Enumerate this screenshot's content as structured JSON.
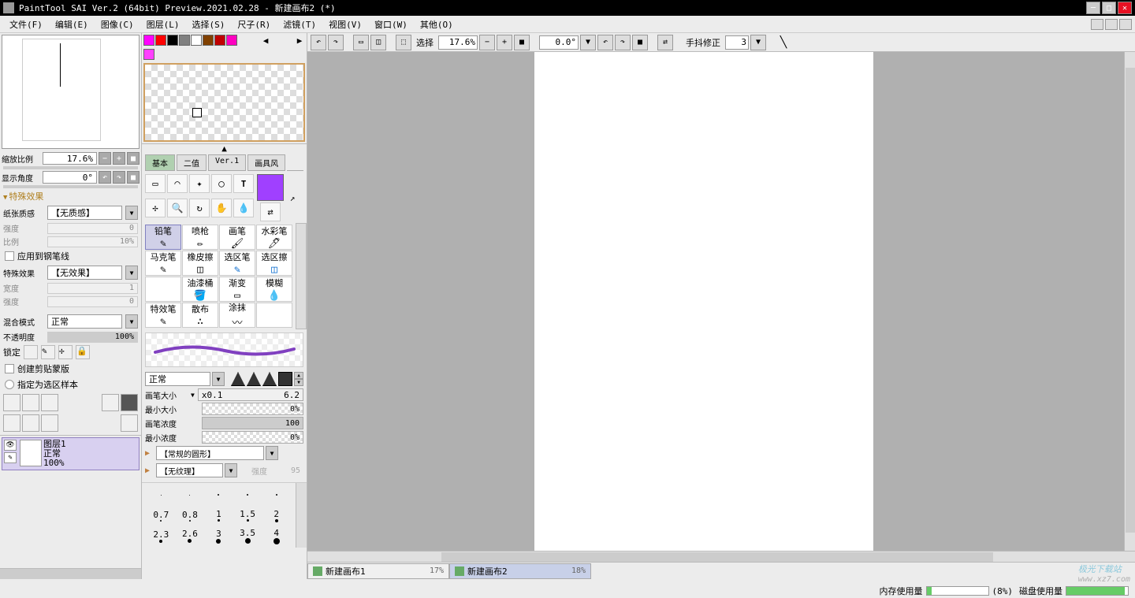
{
  "title": "PaintTool SAI Ver.2 (64bit) Preview.2021.02.28 - 新建画布2 (*)",
  "menu": [
    "文件(F)",
    "编辑(E)",
    "图像(C)",
    "图层(L)",
    "选择(S)",
    "尺子(R)",
    "滤镜(T)",
    "视图(V)",
    "窗口(W)",
    "其他(O)"
  ],
  "toolbar": {
    "select_label": "选择",
    "zoom": "17.6%",
    "rotation": "0.0°",
    "stabilizer_label": "手抖修正",
    "stabilizer_val": "3"
  },
  "nav": {
    "zoom_label": "缩放比例",
    "zoom_val": "17.6%",
    "angle_label": "显示角度",
    "angle_val": "0°"
  },
  "fx": {
    "header": "特殊效果",
    "paper_label": "纸张质感",
    "paper_val": "【无质感】",
    "strength_label": "强度",
    "strength_val": "0",
    "ratio_label": "比例",
    "ratio_val": "10%",
    "apply_pen": "应用到钢笔线",
    "effect_label": "特殊效果",
    "effect_val": "【无效果】",
    "width_label": "宽度",
    "width_val": "1",
    "strength2_label": "强度",
    "strength2_val": "0"
  },
  "blend": {
    "mode_label": "混合模式",
    "mode_val": "正常",
    "opacity_label": "不透明度",
    "opacity_val": "100%"
  },
  "lock": {
    "label": "锁定",
    "clip": "创建剪贴蒙版",
    "selsrc": "指定为选区样本"
  },
  "layer": {
    "name": "图层1",
    "mode": "正常",
    "opacity": "100%"
  },
  "swatches": [
    "#ff00ff",
    "#ff0000",
    "#000000",
    "#808080",
    "#ffffff",
    "#804000",
    "#c00000",
    "#ff00c0"
  ],
  "extra_swatch": "#ff40ff",
  "color_big": "#a040ff",
  "tabs": [
    "基本",
    "二值",
    "Ver.1",
    "画具风"
  ],
  "brushes": [
    {
      "n": "铅笔"
    },
    {
      "n": "喷枪"
    },
    {
      "n": "画笔"
    },
    {
      "n": "水彩笔"
    },
    {
      "n": "马克笔"
    },
    {
      "n": "橡皮擦"
    },
    {
      "n": "选区笔"
    },
    {
      "n": "选区擦"
    },
    {
      "n": ""
    },
    {
      "n": "油漆桶"
    },
    {
      "n": "渐变"
    },
    {
      "n": "模糊"
    },
    {
      "n": "特效笔"
    },
    {
      "n": "散布"
    },
    {
      "n": "涂抹"
    },
    {
      "n": ""
    }
  ],
  "brush_mode": "正常",
  "params": {
    "size_label": "画笔大小",
    "size_mult": "x0.1",
    "size_val": "6.2",
    "minsize_label": "最小大小",
    "minsize_val": "0%",
    "density_label": "画笔浓度",
    "density_val": "100",
    "mindensity_label": "最小浓度",
    "mindensity_val": "0%"
  },
  "tex": {
    "shape": "【常规的圆形】",
    "texture": "【无纹理】",
    "tex_strength_label": "强度",
    "tex_strength_val": "95"
  },
  "dots": {
    "r1": [
      "",
      "",
      ".",
      "",
      ""
    ],
    "l1": [
      "0.7",
      "0.8",
      "1",
      "1.5",
      "2"
    ],
    "l2": [
      "2.3",
      "2.6",
      "3",
      "3.5",
      "4"
    ]
  },
  "doc_tabs": [
    {
      "name": "新建画布1",
      "pct": "17%"
    },
    {
      "name": "新建画布2",
      "pct": "18%"
    }
  ],
  "status": {
    "mem_label": "内存使用量",
    "mem_val": "8%",
    "mem_pct": "(8%)",
    "disk_label": "磁盘使用量",
    "disk_val": "95%"
  },
  "watermark": {
    "brand": "极光下载站",
    "url": "www.xz7.com"
  }
}
